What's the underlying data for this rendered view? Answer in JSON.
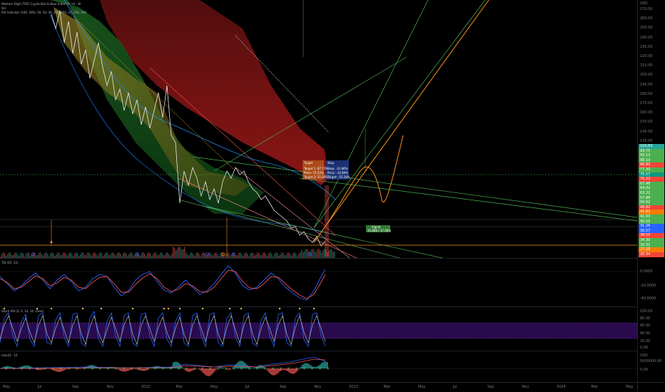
{
  "legends": {
    "main_line1": "Western Digit (TSX) Crypto Bull & Bear Index (30 d) - W",
    "main_line2": "Vol",
    "main_line3": "RSI Indicator (100, 500), 50, 50, 30, 250, 250, 20, 250, 500",
    "tsi": "TSI (25, 13)",
    "stoch": "Stoch RSI (3, 3, 14, 14, close)",
    "macd": "macd3 · 16"
  },
  "time_axis": [
    "May",
    "Jul",
    "Sep",
    "Nov",
    "2022",
    "Mar",
    "May",
    "Jul",
    "Sep",
    "Nov",
    "2023",
    "Mar",
    "May",
    "Jul",
    "Sep",
    "Nov",
    "2024",
    "Mar",
    "May"
  ],
  "price_axis": {
    "currency": "USD",
    "labels": [
      "270.00",
      "260.00",
      "250.00",
      "240.00",
      "230.00",
      "220.00",
      "210.00",
      "200.00",
      "190.00",
      "180.00",
      "170.00",
      "160.00",
      "150.00",
      "140.00",
      "130.00"
    ],
    "tags": [
      {
        "text": "103.83",
        "color": "#26a69a"
      },
      {
        "text": "93.75",
        "color": "#4caf50"
      },
      {
        "text": "93.13",
        "color": "#4caf50"
      },
      {
        "text": "90.10",
        "color": "#4caf50"
      },
      {
        "text": "86.80",
        "color": "#f44336"
      },
      {
        "text": "77.30",
        "color": "#4caf50"
      },
      {
        "text": "75.57",
        "color": "#089981"
      },
      {
        "text": "70.22",
        "color": "#f44336"
      },
      {
        "text": "67.46",
        "color": "#4caf50"
      },
      {
        "text": "64.02",
        "color": "#4caf50"
      },
      {
        "text": "63.22",
        "color": "#4caf50"
      },
      {
        "text": "57.88",
        "color": "#4caf50"
      },
      {
        "text": "50.62",
        "color": "#4caf50"
      },
      {
        "text": "46.82",
        "color": "#f44336"
      },
      {
        "text": "41.83",
        "color": "#f57c00"
      },
      {
        "text": "41.00",
        "color": "#4caf50"
      },
      {
        "text": "40.55",
        "color": "#4caf50"
      },
      {
        "text": "31.26",
        "color": "#2962ff"
      },
      {
        "text": "30.57",
        "color": "#2962ff"
      },
      {
        "text": "38.55",
        "color": "#f44336"
      },
      {
        "text": "34.30",
        "color": "#4caf50"
      },
      {
        "text": "32.31",
        "color": "#4caf50"
      },
      {
        "text": "27.28",
        "color": "#f57c00"
      },
      {
        "text": "25.34",
        "color": "#f44336"
      }
    ]
  },
  "tsi_axis": [
    "0.0000",
    "-20.0000",
    "-40.0000"
  ],
  "stoch_axis": [
    "100.00",
    "80.00",
    "60.00",
    "40.00",
    "20.00",
    "0.00"
  ],
  "macd_axis": {
    "currency": "USD",
    "labels": [
      "5000000.00",
      "0.00"
    ]
  },
  "annotations": {
    "box1_title": "Target",
    "box1_lines": [
      "Target 1: 87.73%",
      "Price: 75.23%",
      "Target 2: 51.09%"
    ],
    "box2_title": "Stop",
    "box2_lines": [
      "Stop: -31.86%",
      "Price: -32.86%",
      "Target: -15.28%"
    ],
    "box3": [
      "Signal",
      "35,886 / 37.86%"
    ]
  },
  "colors": {
    "background": "#000000",
    "up": "#26a69a",
    "down": "#ef5350",
    "orange": "#f7931a",
    "green_line": "#4caf50",
    "red_cloud": "#8b1a1a",
    "green_cloud": "#1b5e20",
    "purple_band": "#4a148c"
  }
}
